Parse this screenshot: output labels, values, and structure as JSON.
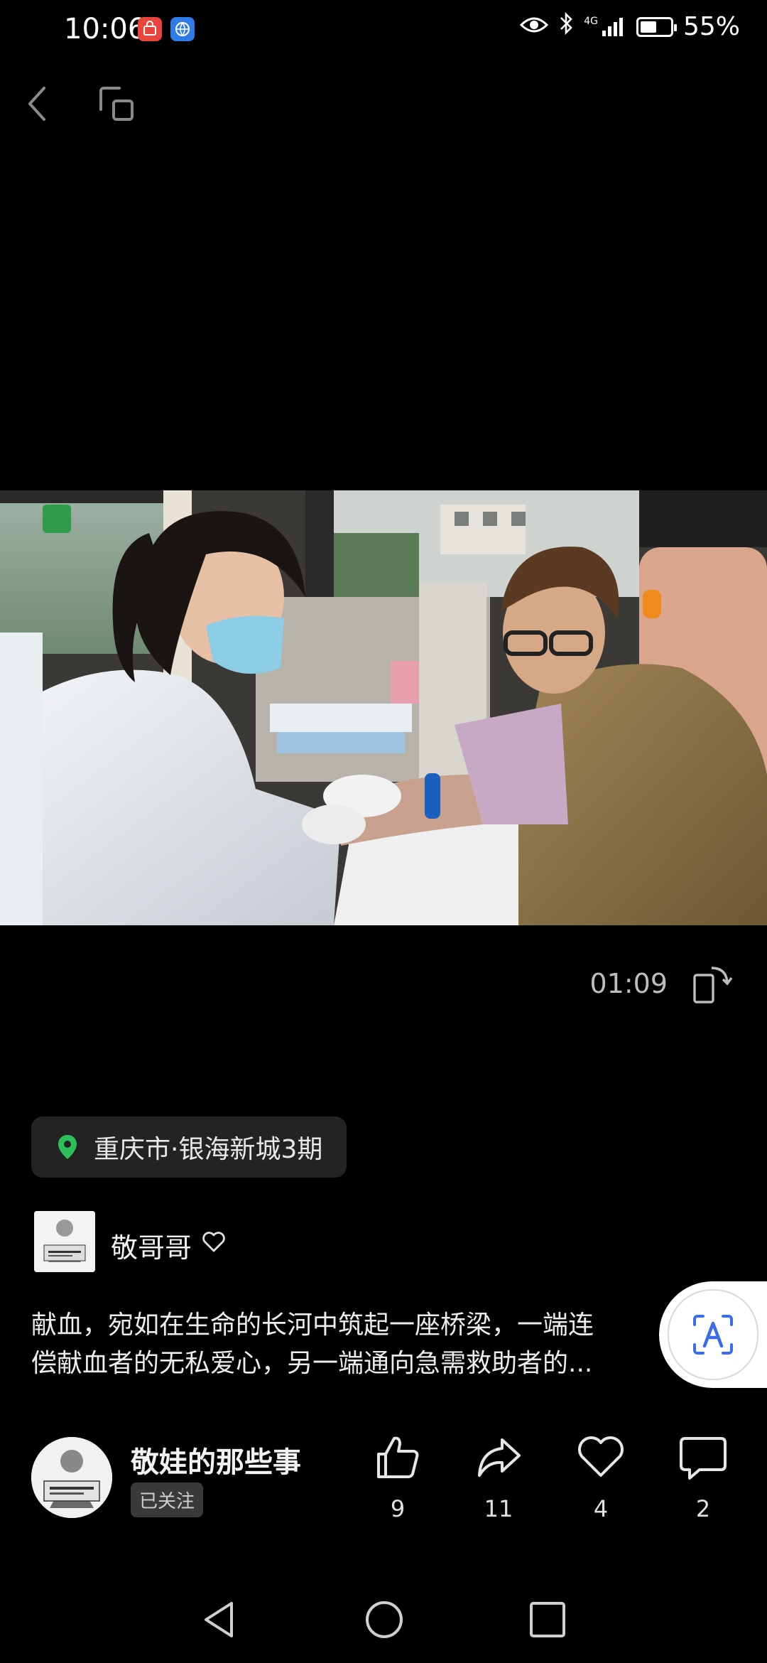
{
  "status_bar": {
    "time": "10:06",
    "network": "4G",
    "battery_percent": "55%",
    "battery_level": 0.55
  },
  "video": {
    "elapsed": "01:09"
  },
  "location": {
    "text": "重庆市·银海新城3期"
  },
  "author": {
    "name": "敬哥哥"
  },
  "caption": {
    "line1": "献血，宛如在生命的长河中筑起一座桥梁，一端连",
    "line2": "偿献血者的无私爱心，另一端通向急需救助者的..."
  },
  "channel": {
    "name": "敬娃的那些事",
    "follow_status": "已关注"
  },
  "actions": {
    "like_count": "9",
    "share_count": "11",
    "favorite_count": "4",
    "comment_count": "2"
  },
  "colors": {
    "background": "#000000",
    "pill": "#232323",
    "location_pin": "#2fbf5a",
    "fab_accent": "#3a6ee8"
  }
}
